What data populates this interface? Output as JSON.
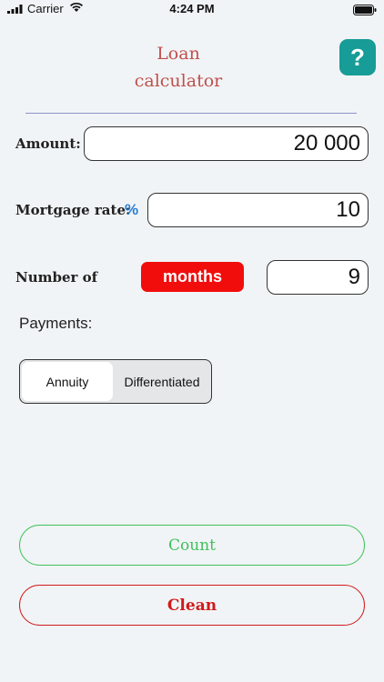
{
  "status_bar": {
    "carrier": "Carrier",
    "time": "4:24 PM",
    "icons": [
      "signal-icon",
      "wifi-icon",
      "battery-icon"
    ]
  },
  "header": {
    "title_line1": "Loan",
    "title_line2": "calculator",
    "help_label": "?"
  },
  "form": {
    "amount_label": "Amount:",
    "amount_value": "20 000",
    "rate_label": "Mortgage rate:",
    "rate_unit": "%",
    "rate_value": "10",
    "number_label": "Number of",
    "period_unit": "months",
    "number_value": "9"
  },
  "payments": {
    "label": "Payments:",
    "options": [
      "Annuity",
      "Differentiated"
    ],
    "selected": "Annuity"
  },
  "actions": {
    "count_label": "Count",
    "clean_label": "Clean"
  },
  "colors": {
    "background": "#f1f4f6",
    "title": "#c0504d",
    "help": "#179c97",
    "months": "#f20d0d",
    "percent": "#2a7fd4",
    "count": "#3ec25a",
    "clean": "#d01a1a"
  }
}
